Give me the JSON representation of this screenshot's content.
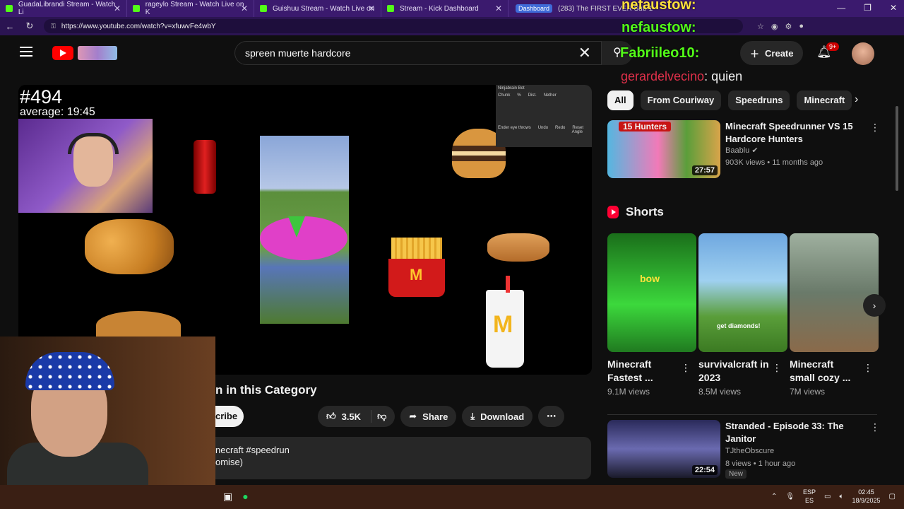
{
  "browser": {
    "tabs": [
      {
        "title": "GuadaLibrandi Stream - Watch Li"
      },
      {
        "title": "rageylo Stream - Watch Live on K"
      },
      {
        "title": "Guishuu Stream - Watch Live on"
      },
      {
        "title": "Stream - Kick Dashboard"
      }
    ],
    "dashboard_badge": "Dashboard",
    "last_tab_title": "(283) The FIRST EVER Sub-1",
    "url": "https://www.youtube.com/watch?v=xfuwvFe4wbY"
  },
  "youtube": {
    "search_query": "spreen muerte hardcore",
    "create_label": "Create",
    "notif_badge": "9+",
    "player": {
      "counter": "#494",
      "average": "average: 19:45",
      "ninjabrain": {
        "title": "Ninjabrain Bot",
        "cols": [
          "Chunk",
          "%",
          "Dist.",
          "Nether"
        ],
        "ender_label": "Ender eye throws",
        "btns": [
          "Undo",
          "Redo",
          "Reset"
        ],
        "angle": "Angle"
      }
    },
    "video_title": "n in this Category",
    "subscribe_label": "cribe",
    "likes": "3.5K",
    "share_label": "Share",
    "download_label": "Download",
    "description_line1": "necraft #speedrun",
    "description_line2": "omise)",
    "chips": [
      "All",
      "From Couriway",
      "Speedruns",
      "Minecraft"
    ],
    "recommended": [
      {
        "title": "Minecraft Speedrunner VS 15 Hardcore Hunters",
        "channel": "Baablu",
        "meta": "903K views • 11 months ago",
        "duration": "27:57",
        "thumb_text": "15 Hunters"
      },
      {
        "title": "Stranded - Episode 33: The Janitor",
        "channel": "TJtheObscure",
        "meta": "8 views • 1 hour ago",
        "duration": "22:54",
        "tag": "New"
      }
    ],
    "shorts_title": "Shorts",
    "shorts": [
      {
        "title": "Minecraft Fastest ...",
        "views": "9.1M views",
        "thumb_text": "bow"
      },
      {
        "title": "survivalcraft in 2023",
        "views": "8.5M views",
        "thumb_text": "get diamonds!"
      },
      {
        "title": "Minecraft small cozy ...",
        "views": "7M views"
      }
    ]
  },
  "chat_overlay": {
    "name1": "nefaustow:",
    "name2": "nefaustow:",
    "name3": "Fabriileo10:",
    "name4": "gerardelvecino",
    "msg4": ": quien"
  },
  "taskbar": {
    "lang_top": "ESP",
    "lang_bottom": "ES",
    "time": "02:45",
    "date": "18/9/2025"
  },
  "colors": {
    "kick_green": "#53fc18",
    "youtube_red": "#ff0000",
    "browser_purple": "#3b1a6e"
  }
}
